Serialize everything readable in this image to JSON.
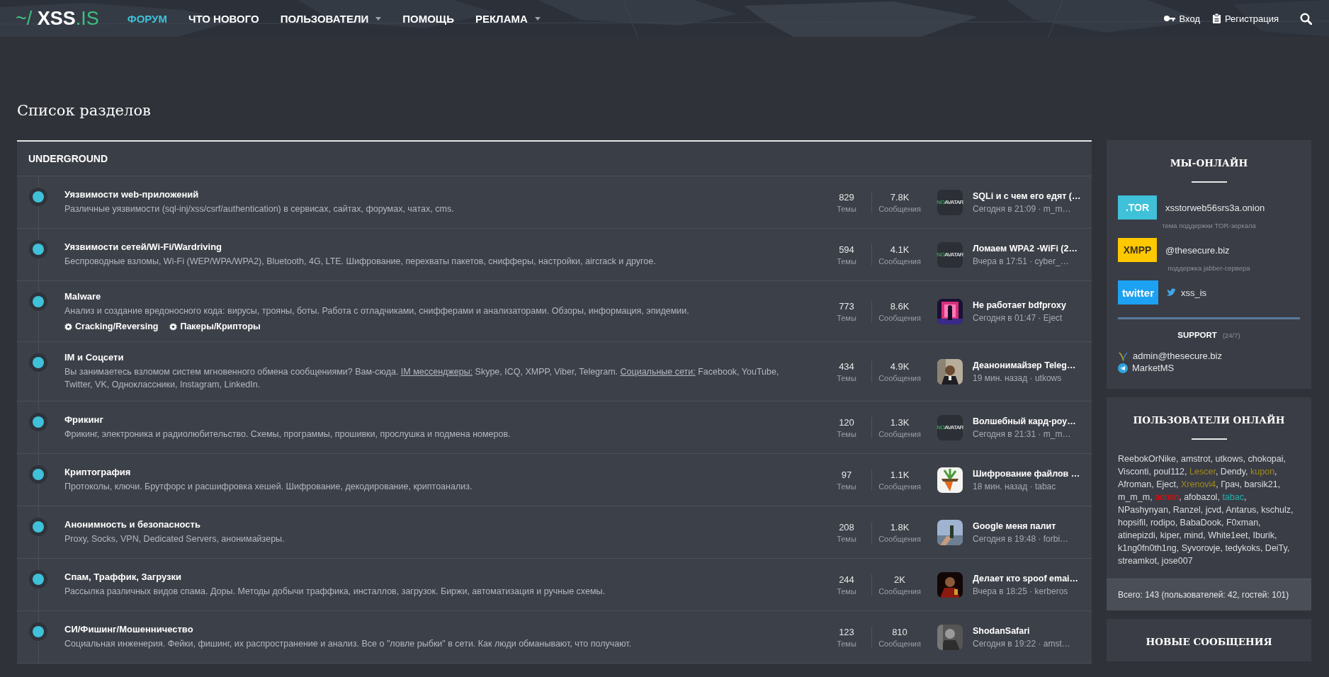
{
  "header": {
    "logo": {
      "prefix": "~/",
      "name": "XSS",
      "suffix": ".IS"
    },
    "nav": [
      {
        "label": "ФОРУМ",
        "selected": true,
        "has_menu": false
      },
      {
        "label": "ЧТО НОВОГО",
        "selected": false,
        "has_menu": false
      },
      {
        "label": "ПОЛЬЗОВАТЕЛИ",
        "selected": false,
        "has_menu": true
      },
      {
        "label": "ПОМОЩЬ",
        "selected": false,
        "has_menu": false
      },
      {
        "label": "РЕКЛАМА",
        "selected": false,
        "has_menu": true
      }
    ],
    "login": "Вход",
    "register": "Регистрация"
  },
  "page_title": "Список разделов",
  "category": "UNDERGROUND",
  "forums": [
    {
      "title": "Уязвимости web-приложений",
      "description": [
        {
          "kind": "text",
          "text": "Различные уязвимости (sql-inj/xss/csrf/authentication) в сервисах, сайтах, форумах, чатах, cms."
        }
      ],
      "threads": "829",
      "threads_label": "Темы",
      "messages": "7.8K",
      "messages_label": "Сообщения",
      "avatar": {
        "kind": "placeholder",
        "text_a": "NO",
        "text_b": "AVATAR"
      },
      "last_title": "SQLi и с чем его едят (…",
      "last_meta": "Сегодня в 21:09 · m_m…"
    },
    {
      "title": "Уязвимости сетей/Wi-Fi/Wardriving",
      "description": [
        {
          "kind": "text",
          "text": "Беспроводные взломы, Wi-Fi (WEP/WPA/WPA2), Bluetooth, 4G, LTE. Шифрование, перехваты пакетов, снифферы, настройки, aircrack и другое."
        }
      ],
      "threads": "594",
      "threads_label": "Темы",
      "messages": "4.1K",
      "messages_label": "Сообщения",
      "avatar": {
        "kind": "placeholder",
        "text_a": "NO",
        "text_b": "AVATAR"
      },
      "last_title": "Ломаем WPA2 -WiFi (2…",
      "last_meta": "Вчера в 17:51 · cyber_…"
    },
    {
      "title": "Malware",
      "description": [
        {
          "kind": "text",
          "text": "Анализ и создание вредоносного кода: вирусы, трояны, боты. Работа с отладчиками, снифферами и анализаторами. Обзоры, информация, эпидемии."
        }
      ],
      "subforums": [
        "Cracking/Reversing",
        "Пакеры/Крипторы"
      ],
      "threads": "773",
      "threads_label": "Темы",
      "messages": "8.6K",
      "messages_label": "Сообщения",
      "avatar": {
        "kind": "picture"
      },
      "last_title": "Не работает bdfproxy",
      "last_meta": "Сегодня в 01:47 · Eject"
    },
    {
      "title": "IM и Соцсети",
      "description": [
        {
          "kind": "text",
          "text": "Вы занимаетесь взломом систем мгновенного обмена сообщениями? Вам-сюда. "
        },
        {
          "kind": "link",
          "text": "IM мессенджеры:"
        },
        {
          "kind": "text",
          "text": " Skype, ICQ, XMPP, Viber, Telegram. "
        },
        {
          "kind": "link",
          "text": "Социальные сети:"
        },
        {
          "kind": "text",
          "text": " Facebook, YouTube, Twitter, VK, Одноклассники, Instagram, LinkedIn."
        }
      ],
      "threads": "434",
      "threads_label": "Темы",
      "messages": "4.9K",
      "messages_label": "Сообщения",
      "avatar": {
        "kind": "picture"
      },
      "last_title": "Деанонимайзер Teleg…",
      "last_meta": "19 мин. назад · utkows"
    },
    {
      "title": "Фрикинг",
      "description": [
        {
          "kind": "text",
          "text": "Фрикинг, электроника и радиолюбительство. Схемы, программы, прошивки, прослушка и подмена номеров."
        }
      ],
      "threads": "120",
      "threads_label": "Темы",
      "messages": "1.3K",
      "messages_label": "Сообщения",
      "avatar": {
        "kind": "placeholder",
        "text_a": "NO",
        "text_b": "AVATAR"
      },
      "last_title": "Волшебный кард-роу…",
      "last_meta": "Сегодня в 21:31 · m_m…"
    },
    {
      "title": "Криптография",
      "description": [
        {
          "kind": "text",
          "text": "Протоколы, ключи. Брутфорс и расшифровка хешей. Шифрование, декодирование, криптоанализ."
        }
      ],
      "threads": "97",
      "threads_label": "Темы",
      "messages": "1.1K",
      "messages_label": "Сообщения",
      "avatar": {
        "kind": "picture"
      },
      "last_title": "Шифрование файлов …",
      "last_meta": "18 мин. назад · tabac"
    },
    {
      "title": "Анонимность и безопасность",
      "description": [
        {
          "kind": "text",
          "text": "Proxy, Socks, VPN, Dedicated Servers, анонимайзеры."
        }
      ],
      "threads": "208",
      "threads_label": "Темы",
      "messages": "1.8K",
      "messages_label": "Сообщения",
      "avatar": {
        "kind": "picture"
      },
      "last_title": "Google меня палит",
      "last_meta": "Сегодня в 19:48 · forbi…"
    },
    {
      "title": "Спам, Траффик, Загрузки",
      "description": [
        {
          "kind": "text",
          "text": "Рассылка различных видов спама. Доры. Методы добычи траффика, инсталлов, загрузок. Биржи, автоматизация и ручные схемы."
        }
      ],
      "threads": "244",
      "threads_label": "Темы",
      "messages": "2K",
      "messages_label": "Сообщения",
      "avatar": {
        "kind": "picture"
      },
      "last_title": "Делает кто spoof emai…",
      "last_meta": "Вчера в 18:25 · kerberos"
    },
    {
      "title": "СИ/Фишинг/Мошенничество",
      "description": [
        {
          "kind": "text",
          "text": "Социальная инженерия. Фейки, фишинг, их распространение и анализ. Все о \"ловле рыбки\" в сети. Как люди обманывают, что получают."
        }
      ],
      "threads": "123",
      "threads_label": "Темы",
      "messages": "810",
      "messages_label": "Сообщения",
      "avatar": {
        "kind": "picture"
      },
      "last_title": "ShodanSafari",
      "last_meta": "Сегодня в 19:22 · amst…"
    }
  ],
  "online_panel": {
    "title": "МЫ-ОНЛАЙН",
    "contacts": [
      {
        "kind": "tor",
        "badge": ".TOR",
        "value": "xsstorweb56srs3a.onion",
        "caption": "тема поддержки TOR-зеркала"
      },
      {
        "kind": "xmpp",
        "badge": "XMPP",
        "value": "@thesecure.biz",
        "caption": "поддержка jabber-сервера"
      },
      {
        "kind": "twitter",
        "badge": "twitter",
        "value": "xss_is"
      }
    ],
    "support_title": "SUPPORT",
    "support_hours": "(24/7)",
    "support": [
      {
        "kind": "xmpp",
        "text": "admin@thesecure.biz"
      },
      {
        "kind": "telegram",
        "text": "MarketMS"
      }
    ]
  },
  "users_panel": {
    "title": "ПОЛЬЗОВАТЕЛИ ОНЛАЙН",
    "separator": ",",
    "users": [
      {
        "name": "ReebokOrNike",
        "color": "#dcdde0"
      },
      {
        "name": "amstrot",
        "color": "#dcdde0"
      },
      {
        "name": "utkows",
        "color": "#dcdde0"
      },
      {
        "name": "chokopai",
        "color": "#dcdde0"
      },
      {
        "name": "Visconti",
        "color": "#dcdde0"
      },
      {
        "name": "poul112",
        "color": "#dcdde0"
      },
      {
        "name": "Lescer",
        "color": "#a08a1c"
      },
      {
        "name": "Dendy",
        "color": "#dcdde0"
      },
      {
        "name": "kupon",
        "color": "#a08a1c"
      },
      {
        "name": "Afroman",
        "color": "#dcdde0"
      },
      {
        "name": "Eject",
        "color": "#dcdde0"
      },
      {
        "name": "Xrenovi4",
        "color": "#a08a1c"
      },
      {
        "name": "Грач",
        "color": "#dcdde0"
      },
      {
        "name": "barsik21",
        "color": "#dcdde0"
      },
      {
        "name": "m_m_m",
        "color": "#dcdde0"
      },
      {
        "name": "admin",
        "color": "#ff0000"
      },
      {
        "name": "afobazol",
        "color": "#dcdde0"
      },
      {
        "name": "tabac",
        "color": "#1fb5ad"
      },
      {
        "name": "NPashynyan",
        "color": "#dcdde0"
      },
      {
        "name": "Ranzel",
        "color": "#dcdde0"
      },
      {
        "name": "jcvd",
        "color": "#dcdde0"
      },
      {
        "name": "Antarus",
        "color": "#dcdde0"
      },
      {
        "name": "kschulz",
        "color": "#dcdde0"
      },
      {
        "name": "hopsifil",
        "color": "#dcdde0"
      },
      {
        "name": "rodipo",
        "color": "#dcdde0"
      },
      {
        "name": "BabaDook",
        "color": "#dcdde0"
      },
      {
        "name": "F0xman",
        "color": "#dcdde0"
      },
      {
        "name": "atinepizdi",
        "color": "#dcdde0"
      },
      {
        "name": "kiper",
        "color": "#dcdde0"
      },
      {
        "name": "mind",
        "color": "#dcdde0"
      },
      {
        "name": "White1eet",
        "color": "#dcdde0"
      },
      {
        "name": "Iburik",
        "color": "#dcdde0"
      },
      {
        "name": "k1ng0fn0th1ng",
        "color": "#dcdde0"
      },
      {
        "name": "Syvorovje",
        "color": "#dcdde0"
      },
      {
        "name": "tedykoks",
        "color": "#dcdde0"
      },
      {
        "name": "DeiTy",
        "color": "#dcdde0"
      },
      {
        "name": "streamkot",
        "color": "#dcdde0"
      },
      {
        "name": "jose007",
        "color": "#dcdde0"
      }
    ],
    "total": "Всего: 143 (пользователей: 42, гостей: 101)"
  },
  "new_posts_panel": {
    "title": "НОВЫЕ СООБЩЕНИЯ"
  }
}
